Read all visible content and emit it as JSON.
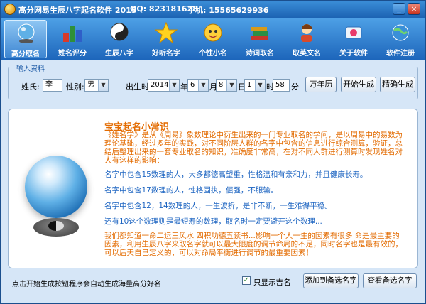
{
  "window": {
    "title": "高分网易生辰八字起名软件 2015",
    "qq": "QQ: 823181628",
    "phone": "手机: 15565629936",
    "min_glyph": "_",
    "close_glyph": "×"
  },
  "toolbar": {
    "items": [
      {
        "label": "高分取名",
        "icon": "crystal-ball-icon",
        "active": true
      },
      {
        "label": "姓名评分",
        "icon": "chart-cubes-icon",
        "active": false
      },
      {
        "label": "生辰八字",
        "icon": "yin-yang-icon",
        "active": false
      },
      {
        "label": "好听名字",
        "icon": "star-icon",
        "active": false
      },
      {
        "label": "个性小名",
        "icon": "cartoon-face-icon",
        "active": false
      },
      {
        "label": "诗词取名",
        "icon": "books-icon",
        "active": false
      },
      {
        "label": "取英文名",
        "icon": "person-icon",
        "active": false
      },
      {
        "label": "关于软件",
        "icon": "info-icon",
        "active": false
      },
      {
        "label": "软件注册",
        "icon": "globe-icon",
        "active": false
      }
    ]
  },
  "input": {
    "legend": "输入资料",
    "surname_label": "姓氏:",
    "surname_value": "李",
    "gender_label": "性别:",
    "gender_value": "男",
    "birth_label": "出生时间:",
    "year_value": "2014",
    "year_unit": "年",
    "month_value": "6",
    "month_unit": "月",
    "day_value": "8",
    "day_unit": "日",
    "hour_value": "1",
    "hour_unit": "时",
    "minute_value": "58",
    "minute_unit": "分",
    "calendar_button": "万年历",
    "generate_button": "开始生成",
    "precise_button": "精确生成"
  },
  "panel": {
    "title": "宝宝起名小常识",
    "intro": "《姓名学》是从《周易》象数理论中衍生出来的一门专业取名的学问，是以周易中的易数为理论基础，经过多年的实践，对不同阶层人群的名字中包含的信息进行综合测算，验证，总结后整理出来的一套专业取名的知识，准确度非常高，在对不同人群进行测算时发现姓名对人有这样的影响：",
    "line1": "名字中包含15数理的人，大多都德高望重，性格温和有亲和力，并且健康长寿。",
    "line2": "名字中包含17数理的人，性格固执，倔强，不服输。",
    "line3": "名字中包含12，14数理的人，一生波折，是非不断，一生难得平稳。",
    "line4": "还有10这个数理则是最短寿的数理，取名时一定要避开这个数理...",
    "outro": "我们都知道一命二运三风水 四积功德五读书...影响一个人一生的因素有很多 命是最主要的因素，利用生辰八字来取名字就可以最大限度的调节命局的不足，同时名字也是最有效的，可以后天自己定义的，可以对命局平衡进行调节的最重要因素！"
  },
  "footer": {
    "hint": "点击开始生成按钮程序会自动生成海量高分好名",
    "only_lucky_label": "只显示吉名",
    "only_lucky_checked": "✓",
    "add_button": "添加到备选名字",
    "view_button": "查看备选名字"
  }
}
